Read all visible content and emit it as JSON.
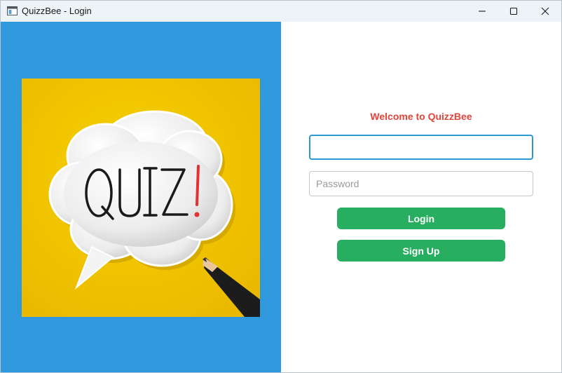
{
  "window": {
    "title": "QuizzBee - Login",
    "app_icon": "window-app-icon",
    "controls": [
      "minimize-icon",
      "maximize-icon",
      "close-icon"
    ]
  },
  "left_panel": {
    "background": "#3098dc",
    "image": {
      "description_icon": "quiz-speech-bubble-image",
      "text": "QUIZ!",
      "background": "#f2c400"
    }
  },
  "login_form": {
    "welcome": "Welcome to QuizzBee",
    "welcome_color": "#e0443b",
    "username": {
      "value": "",
      "placeholder": ""
    },
    "password": {
      "value": "",
      "placeholder": "Password"
    },
    "login_label": "Login",
    "signup_label": "Sign Up",
    "button_color": "#27ae60"
  }
}
